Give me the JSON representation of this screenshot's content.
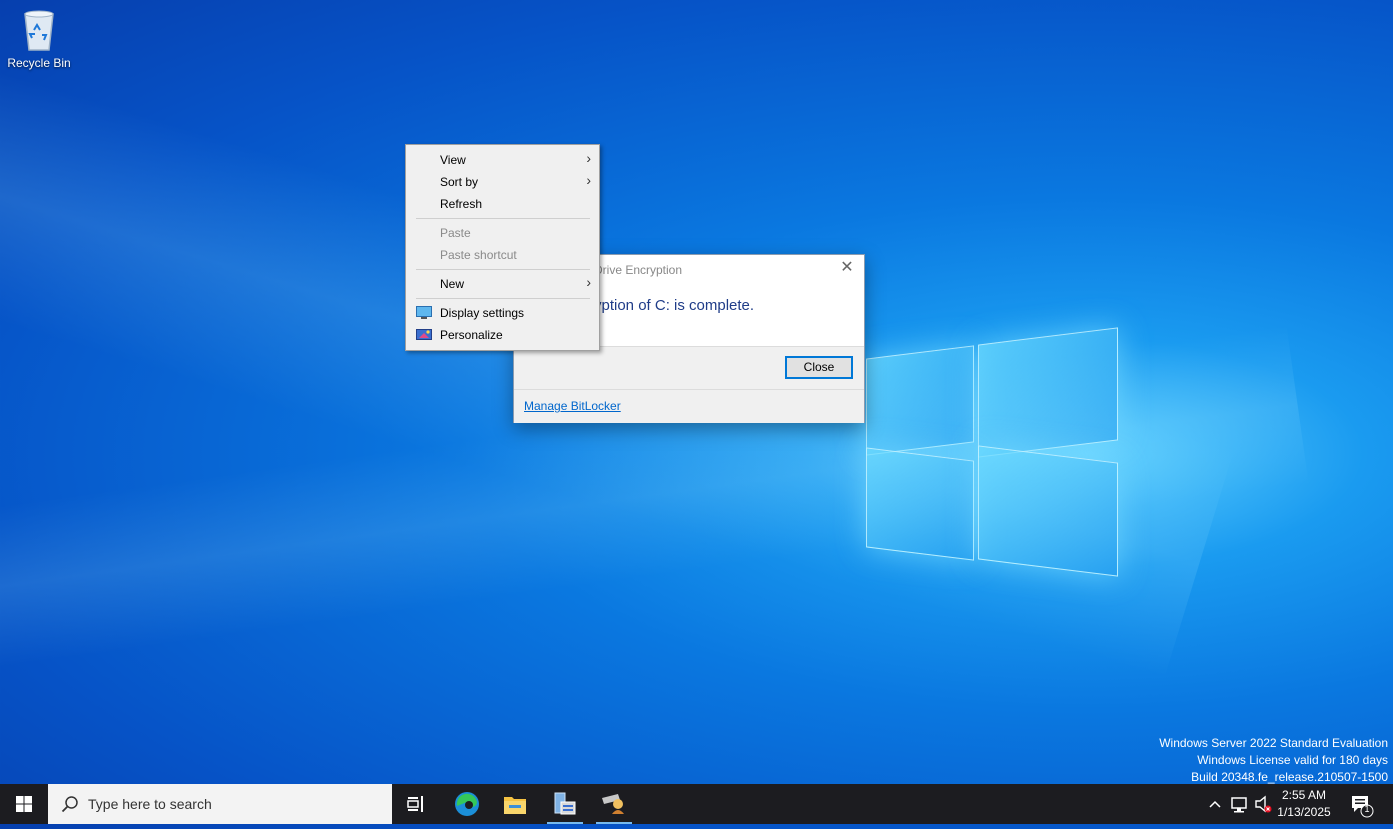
{
  "desktop": {
    "icons": [
      {
        "label": "Recycle Bin",
        "icon": "recycle-bin-icon"
      }
    ]
  },
  "context_menu": {
    "items": [
      {
        "label": "View",
        "submenu": true,
        "enabled": true
      },
      {
        "label": "Sort by",
        "submenu": true,
        "enabled": true
      },
      {
        "label": "Refresh",
        "enabled": true
      },
      {
        "label": "Paste",
        "enabled": false
      },
      {
        "label": "Paste shortcut",
        "enabled": false
      },
      {
        "label": "New",
        "submenu": true,
        "enabled": true
      },
      {
        "label": "Display settings",
        "icon": "display-icon",
        "enabled": true
      },
      {
        "label": "Personalize",
        "icon": "personalize-icon",
        "enabled": true
      }
    ]
  },
  "dialog": {
    "title": "Drive Encryption",
    "message": "yption of C: is complete.",
    "close_button": "Close",
    "link": "Manage BitLocker"
  },
  "watermark": {
    "line1": "Windows Server 2022 Standard Evaluation",
    "line2": "Windows License valid for 180 days",
    "line3": "Build 20348.fe_release.210507-1500"
  },
  "taskbar": {
    "search_placeholder": "Type here to search",
    "apps": [
      "task-view-icon",
      "edge-icon",
      "file-explorer-icon",
      "server-manager-icon",
      "user-app-icon"
    ],
    "clock": {
      "time": "2:55 AM",
      "date": "1/13/2025"
    },
    "notification_count": "1"
  },
  "colors": {
    "accent": "#0078d7",
    "taskbar": "#1c1c20"
  }
}
